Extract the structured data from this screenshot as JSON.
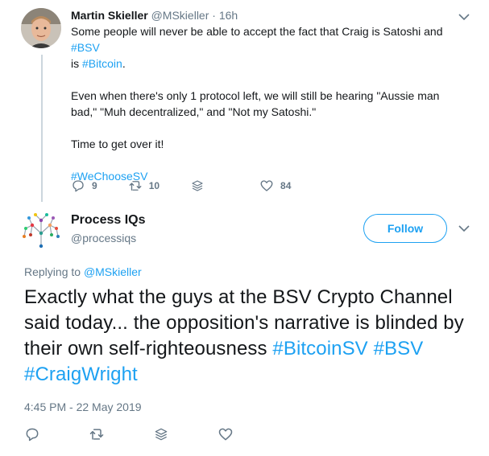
{
  "tweet1": {
    "name": "Martin Skieller",
    "handle": "@MSkieller",
    "separator": "·",
    "time": "16h",
    "line1_a": "Some people will never be able to accept the fact that Craig is Satoshi and ",
    "line1_tag": "#BSV",
    "line1_b": "is ",
    "line1_tag2": "#Bitcoin",
    "line1_end": ".",
    "para2": "Even when there's only 1 protocol left, we will still be hearing \"Aussie man bad,\" \"Muh decentralized,\" and \"Not my Satoshi.\"",
    "para3": "Time to get over it!",
    "hashtag": "#WeChooseSV",
    "replies": "9",
    "retweets": "10",
    "likes": "84"
  },
  "tweet2": {
    "name": "Process IQs",
    "handle": "@processiqs",
    "follow_label": "Follow",
    "replying_prefix": "Replying to ",
    "replying_to": "@MSkieller",
    "text": "Exactly what the guys at the BSV Crypto Channel said today... the opposition's narrative is blinded by their own self-righteousness ",
    "tag1": "#BitcoinSV",
    "tag2": "#BSV",
    "tag3": "#CraigWright",
    "timestamp": "4:45 PM - 22 May 2019"
  },
  "colors": {
    "accent": "#1da1f2",
    "muted": "#657786",
    "text": "#14171a",
    "thread": "#ccd6dd"
  },
  "icons": [
    "reply-icon",
    "retweet-icon",
    "stack-icon",
    "heart-icon",
    "chevron-down-icon"
  ]
}
